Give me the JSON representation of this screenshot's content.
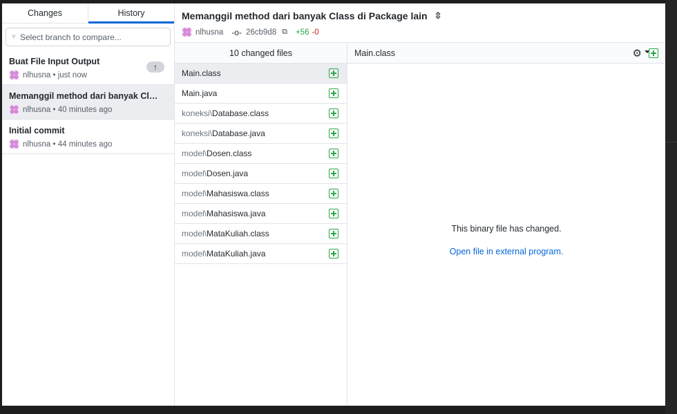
{
  "sidebar": {
    "tabs": [
      {
        "label": "Changes"
      },
      {
        "label": "History"
      }
    ],
    "branch_placeholder": "Select branch to compare...",
    "commits": [
      {
        "title": "Buat File Input Output",
        "author": "nlhusna",
        "time": "just now",
        "push_icon": "arrow-up-icon"
      },
      {
        "title": "Memanggil method dari banyak Class di Package lain",
        "author": "nlhusna",
        "time": "40 minutes ago"
      },
      {
        "title": "Initial commit",
        "author": "nlhusna",
        "time": "44 minutes ago"
      }
    ]
  },
  "header": {
    "title": "Memanggil method dari banyak Class di Package lain",
    "author": "nlhusna",
    "sha": "26cb9d8",
    "additions": "+56",
    "deletions": "-0"
  },
  "files": {
    "count_label": "10 changed files",
    "items": [
      {
        "dir": "",
        "name": "Main.class"
      },
      {
        "dir": "",
        "name": "Main.java"
      },
      {
        "dir": "koneksi\\",
        "name": "Database.class"
      },
      {
        "dir": "koneksi\\",
        "name": "Database.java"
      },
      {
        "dir": "model\\",
        "name": "Dosen.class"
      },
      {
        "dir": "model\\",
        "name": "Dosen.java"
      },
      {
        "dir": "model\\",
        "name": "Mahasiswa.class"
      },
      {
        "dir": "model\\",
        "name": "Mahasiswa.java"
      },
      {
        "dir": "model\\",
        "name": "MataKuliah.class"
      },
      {
        "dir": "model\\",
        "name": "MataKuliah.java"
      }
    ]
  },
  "diff": {
    "filename": "Main.class",
    "message": "This binary file has changed.",
    "link": "Open file in external program."
  },
  "colors": {
    "accent": "#0366d6",
    "added": "#28a745",
    "deleted": "#cb2431"
  }
}
